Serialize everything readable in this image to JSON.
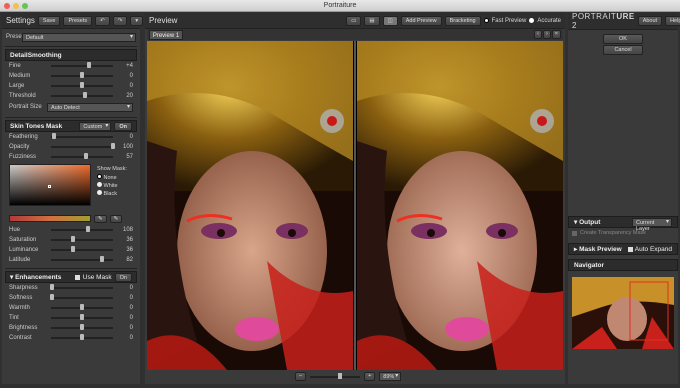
{
  "window": {
    "title": "Portraiture"
  },
  "left": {
    "title": "Settings",
    "save": "Save",
    "presets": "Presets",
    "preset_label": "Preset",
    "preset_value": "Default",
    "detail": {
      "header": "DetailSmoothing",
      "rows": [
        {
          "label": "Fine",
          "value": "+4",
          "pct": 0.62
        },
        {
          "label": "Medium",
          "value": "0",
          "pct": 0.5
        },
        {
          "label": "Large",
          "value": "0",
          "pct": 0.5
        },
        {
          "label": "Threshold",
          "value": "20",
          "pct": 0.55
        }
      ],
      "portrait_size_label": "Portrait Size",
      "portrait_size_value": "Auto Detect"
    },
    "skin": {
      "header": "Skin Tones Mask",
      "mode": "Custom",
      "toggle": "On",
      "rows": [
        {
          "label": "Feathering",
          "value": "0",
          "pct": 0.05
        },
        {
          "label": "Opacity",
          "value": "100",
          "pct": 1.0
        },
        {
          "label": "Fuzziness",
          "value": "57",
          "pct": 0.57
        }
      ],
      "show_mask_label": "Show Mask:",
      "show_mask_options": [
        "None",
        "White",
        "Black"
      ],
      "hue_rows": [
        {
          "label": "Hue",
          "value": "108",
          "pct": 0.6
        },
        {
          "label": "Saturation",
          "value": "36",
          "pct": 0.36
        },
        {
          "label": "Luminance",
          "value": "36",
          "pct": 0.36
        },
        {
          "label": "Latitude",
          "value": "82",
          "pct": 0.82
        }
      ]
    },
    "enh": {
      "header": "Enhancements",
      "use_mask": "Use Mask",
      "toggle": "On",
      "rows": [
        {
          "label": "Sharpness",
          "value": "0",
          "pct": 0.02
        },
        {
          "label": "Softness",
          "value": "0",
          "pct": 0.02
        },
        {
          "label": "Warmth",
          "value": "0",
          "pct": 0.5
        },
        {
          "label": "Tint",
          "value": "0",
          "pct": 0.5
        },
        {
          "label": "Brightness",
          "value": "0",
          "pct": 0.5
        },
        {
          "label": "Contrast",
          "value": "0",
          "pct": 0.5
        }
      ]
    }
  },
  "center": {
    "title": "Preview",
    "add_preview": "Add Preview",
    "bracketing": "Bracketing",
    "fast_preview": "Fast Preview",
    "accurate": "Accurate",
    "tab": "Preview 1",
    "zoom": "89%"
  },
  "right": {
    "brand_a": "PORTRAIT",
    "brand_b": "URE",
    "brand_num": "2",
    "about": "About",
    "help": "Help",
    "ok": "OK",
    "cancel": "Cancel",
    "output": "Output",
    "output_value": "Current Layer",
    "create_mask": "Create Transparency Mask",
    "mask_preview": "Mask Preview",
    "auto_expand": "Auto Expand",
    "navigator": "Navigator"
  }
}
